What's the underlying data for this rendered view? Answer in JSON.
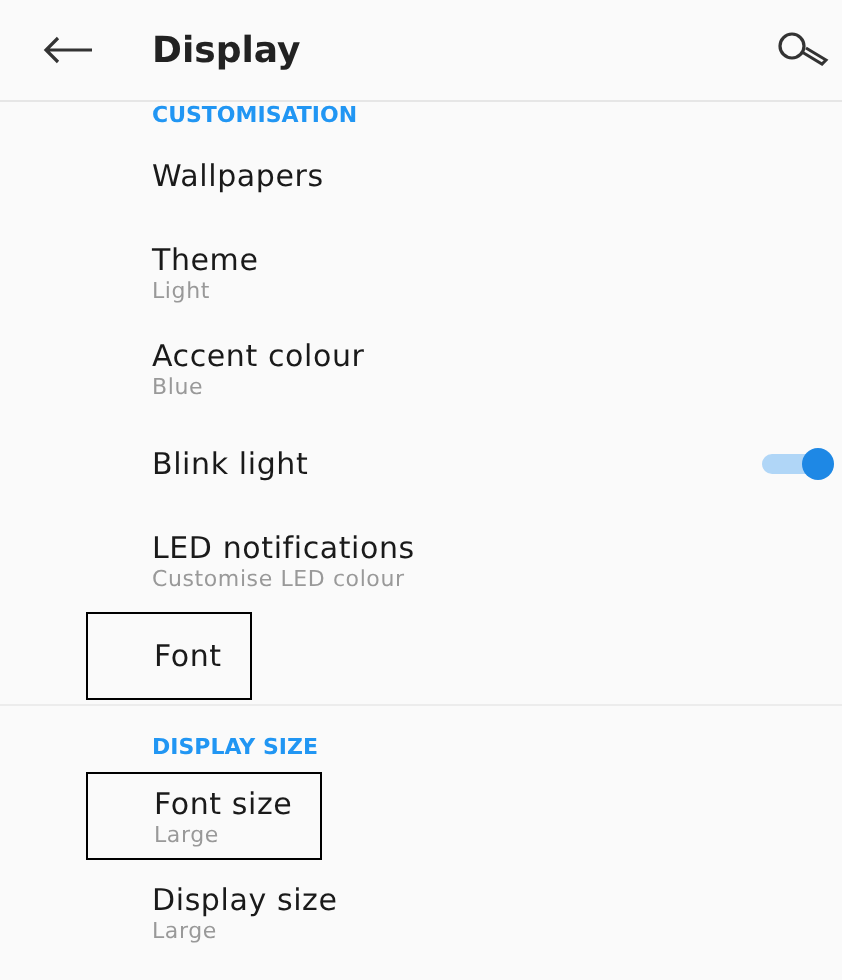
{
  "header": {
    "title": "Display"
  },
  "sections": [
    {
      "heading": "CUSTOMISATION",
      "items": [
        {
          "kind": "item",
          "title": "Wallpapers",
          "outlined": false
        },
        {
          "kind": "item",
          "title": "Theme",
          "subtitle": "Light",
          "outlined": false
        },
        {
          "kind": "item",
          "title": "Accent colour",
          "subtitle": "Blue",
          "outlined": false
        },
        {
          "kind": "toggle",
          "title": "Blink light",
          "on": true,
          "outlined": false
        },
        {
          "kind": "item",
          "title": "LED notifications",
          "subtitle": "Customise LED colour",
          "outlined": false
        },
        {
          "kind": "item",
          "title": "Font",
          "outlined": true
        }
      ]
    },
    {
      "heading": "DISPLAY SIZE",
      "items": [
        {
          "kind": "item",
          "title": "Font size",
          "subtitle": "Large",
          "outlined": true
        },
        {
          "kind": "item",
          "title": "Display size",
          "subtitle": "Large",
          "outlined": false
        }
      ]
    }
  ]
}
